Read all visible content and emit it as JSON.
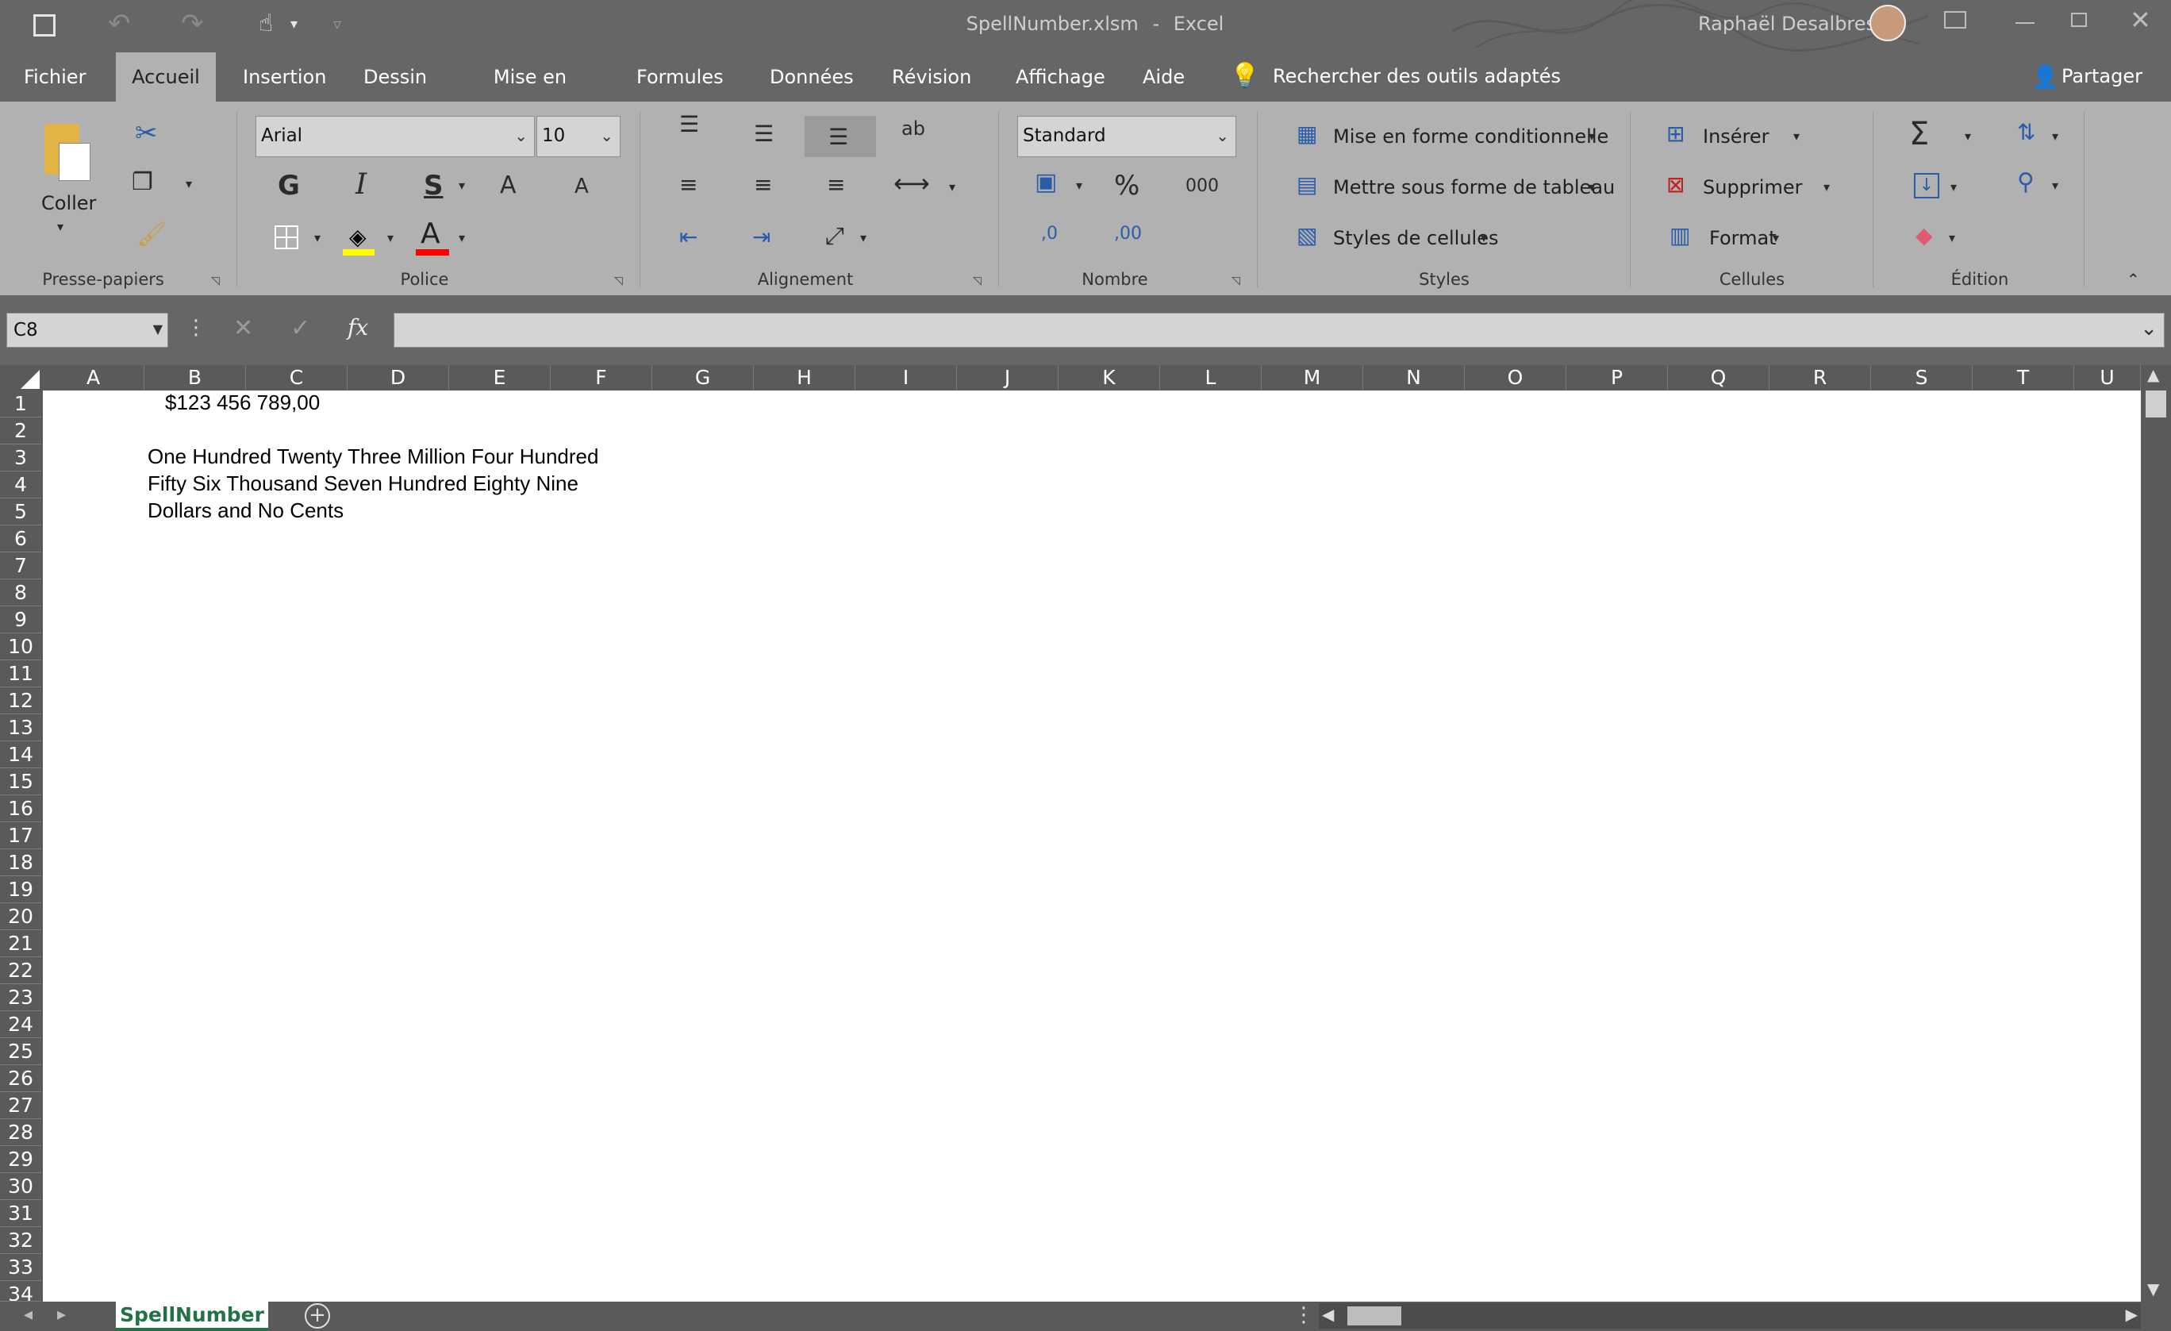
{
  "title": {
    "filename": "SpellNumber.xlsm",
    "separator": "-",
    "app": "Excel",
    "user": "Raphaël Desalbres"
  },
  "tabs": [
    "Fichier",
    "Accueil",
    "Insertion",
    "Dessin",
    "Mise en page",
    "Formules",
    "Données",
    "Révision",
    "Affichage",
    "Aide"
  ],
  "tell_me": "Rechercher des outils adaptés",
  "share": "Partager",
  "ribbon": {
    "clipboard": {
      "paste": "Coller",
      "label": "Presse-papiers"
    },
    "font": {
      "name": "Arial",
      "size": "10",
      "bold": "G",
      "italic": "I",
      "underline": "S",
      "grow": "A",
      "shrink": "A",
      "color_letter": "A",
      "label": "Police"
    },
    "alignment": {
      "label": "Alignement",
      "wrap": "ab"
    },
    "number": {
      "format": "Standard",
      "percent": "%",
      "thousands": "000",
      "inc_dec": ",0",
      "dec_dec": ",00",
      "label": "Nombre"
    },
    "styles": {
      "conditional": "Mise en forme conditionnelle",
      "table": "Mettre sous forme de tableau",
      "cell_styles": "Styles de cellules",
      "label": "Styles"
    },
    "cells": {
      "insert": "Insérer",
      "delete": "Supprimer",
      "format": "Format",
      "label": "Cellules"
    },
    "editing": {
      "sum": "Σ",
      "label": "Édition"
    }
  },
  "formula_bar": {
    "name_box": "C8",
    "fx": "fx",
    "value": ""
  },
  "columns": [
    "A",
    "B",
    "C",
    "D",
    "E",
    "F",
    "G",
    "H",
    "I",
    "J",
    "K",
    "L",
    "M",
    "N",
    "O",
    "P",
    "Q",
    "R",
    "S",
    "T",
    "U"
  ],
  "rows": [
    "1",
    "2",
    "3",
    "4",
    "5",
    "6",
    "7",
    "8",
    "9",
    "10",
    "11",
    "12",
    "13",
    "14",
    "15",
    "16",
    "17",
    "18",
    "19",
    "20",
    "21",
    "22",
    "23",
    "24",
    "25",
    "26",
    "27",
    "28",
    "29",
    "30",
    "31",
    "32",
    "33",
    "34"
  ],
  "cells": {
    "r1": "$123 456 789,00",
    "r3": "One Hundred Twenty Three Million Four Hundred",
    "r4": "Fifty Six Thousand Seven Hundred Eighty Nine",
    "r5": "Dollars and No Cents"
  },
  "sheet_tab": "SpellNumber",
  "colors": {
    "chrome": "#666666",
    "ribbon": "#b1b1b1",
    "header": "#5a5a5a",
    "sheet_tab_text": "#217346"
  }
}
